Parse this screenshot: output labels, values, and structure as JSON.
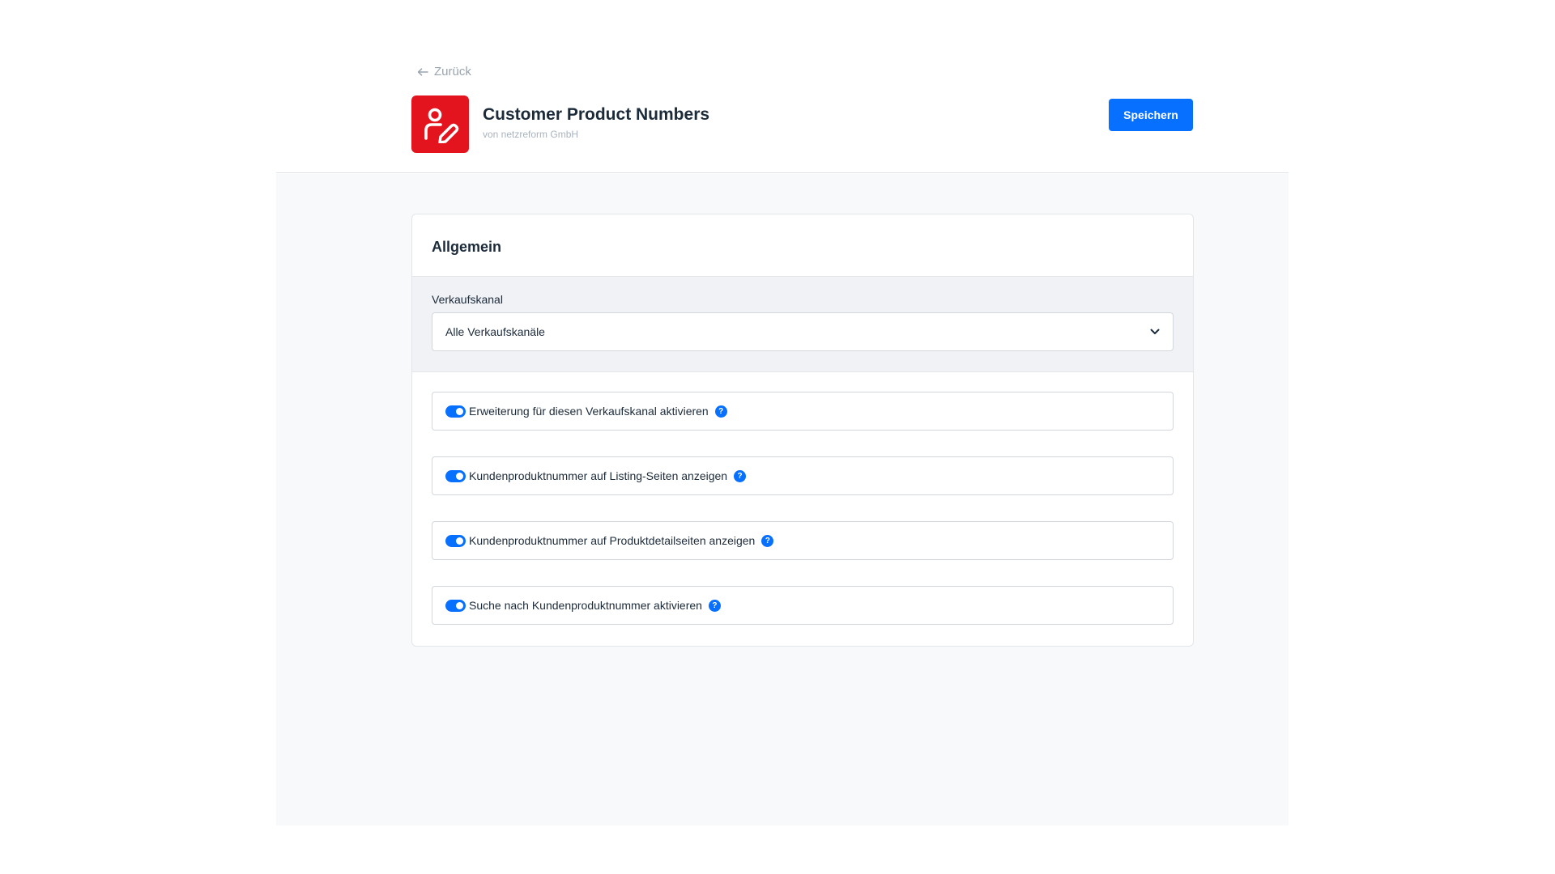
{
  "header": {
    "back_label": "Zurück",
    "app_title": "Customer Product Numbers",
    "app_vendor": "von netzreform GmbH",
    "save_label": "Speichern",
    "app_icon": "user-pen-icon",
    "accent_color": "#0870ff",
    "brand_color": "#e3141e"
  },
  "card": {
    "title": "Allgemein",
    "channel": {
      "label": "Verkaufskanal",
      "selected": "Alle Verkaufskanäle"
    },
    "options": [
      {
        "label": "Erweiterung für diesen Verkaufskanal aktivieren",
        "enabled": true,
        "help": "?"
      },
      {
        "label": "Kundenproduktnummer auf Listing-Seiten anzeigen",
        "enabled": true,
        "help": "?"
      },
      {
        "label": "Kundenproduktnummer auf Produktdetailseiten anzeigen",
        "enabled": true,
        "help": "?"
      },
      {
        "label": "Suche nach Kundenproduktnummer aktivieren",
        "enabled": true,
        "help": "?"
      }
    ]
  }
}
